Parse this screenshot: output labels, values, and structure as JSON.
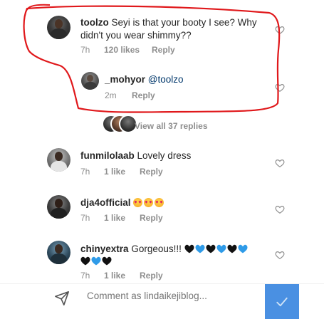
{
  "comments": [
    {
      "username": "toolzo",
      "text_line1": "Seyi is that your booty I see? Why",
      "text_line2": "didn't you wear shimmy??",
      "time": "7h",
      "likes": "120 likes",
      "reply": "Reply"
    },
    {
      "username": "_mohyor",
      "mention": "@toolzo",
      "time": "2m",
      "reply": "Reply"
    },
    {
      "username": "funmilolaab",
      "text": "Lovely dress",
      "time": "7h",
      "likes": "1 like",
      "reply": "Reply"
    },
    {
      "username": "dja4official",
      "emojis": [
        "heart-eyes-face-emoji",
        "heart-eyes-face-emoji",
        "heart-eyes-face-emoji"
      ],
      "time": "7h",
      "likes": "1 like",
      "reply": "Reply"
    },
    {
      "username": "chinyextra",
      "text": "Gorgeous!!!",
      "emojis_line1": [
        "black-heart",
        "blue-heart",
        "black-heart",
        "blue-heart",
        "black-heart",
        "blue-heart"
      ],
      "emojis_line2": [
        "black-heart",
        "blue-heart",
        "black-heart"
      ],
      "time": "7h",
      "likes": "1 like",
      "reply": "Reply"
    }
  ],
  "view_replies": "View all 37 replies",
  "comment_input": {
    "placeholder": "Comment as lindaikejiblog..."
  },
  "icons": {
    "like": "heart-outline-icon",
    "send": "send-icon",
    "post": "checkmark-icon"
  },
  "colors": {
    "annotation": "#e0181b",
    "post_button": "#4a90e2",
    "meta_text": "#8e8e8e",
    "mention": "#00376b",
    "black_heart": "#111111",
    "blue_heart": "#2f9be8"
  }
}
